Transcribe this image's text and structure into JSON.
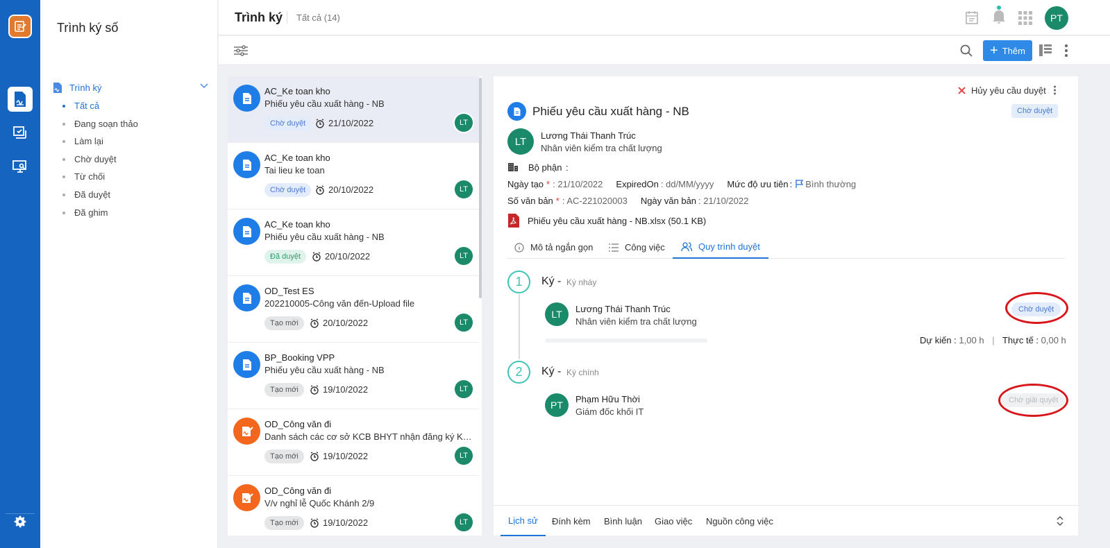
{
  "app": {
    "nav_title": "Trình ký số"
  },
  "sidebar": {
    "group": "Trình ký",
    "items": [
      {
        "label": "Tất cả",
        "active": true
      },
      {
        "label": "Đang soạn thảo"
      },
      {
        "label": "Làm lại"
      },
      {
        "label": "Chờ duyệt"
      },
      {
        "label": "Từ chối"
      },
      {
        "label": "Đã duyệt"
      },
      {
        "label": "Đã ghim"
      }
    ]
  },
  "header": {
    "title": "Trình ký",
    "count_label": "Tất cả (14)",
    "user_initials": "PT"
  },
  "toolbar": {
    "add_label": "Thêm"
  },
  "list": [
    {
      "code": "AC_Ke toan kho",
      "title": "Phiếu yêu cầu xuất hàng - NB",
      "status": "Chờ duyệt",
      "date": "21/10/2022",
      "avatar": "LT",
      "icon": "document-icon"
    },
    {
      "code": "AC_Ke toan kho",
      "title": "Tai lieu ke toan",
      "status": "Chờ duyệt",
      "date": "20/10/2022",
      "avatar": "LT",
      "icon": "document-icon"
    },
    {
      "code": "AC_Ke toan kho",
      "title": "Phiếu yêu cầu xuất hàng - NB",
      "status": "Đã duyệt",
      "date": "20/10/2022",
      "avatar": "LT",
      "icon": "document-icon"
    },
    {
      "code": "OD_Test ES",
      "title": "202210005-Công văn đến-Upload file",
      "status": "Tạo mới",
      "date": "20/10/2022",
      "avatar": "LT",
      "icon": "document-icon"
    },
    {
      "code": "BP_Booking VPP",
      "title": "Phiếu yêu cầu xuất hàng - NB",
      "status": "Tạo mới",
      "date": "19/10/2022",
      "avatar": "LT",
      "icon": "document-icon"
    },
    {
      "code": "OD_Công văn đi",
      "title": "Danh sách các cơ sở KCB BHYT nhận đăng ký KCB ban đầu",
      "status": "Tạo mới",
      "date": "19/10/2022",
      "avatar": "LT",
      "icon": "sign-document-icon"
    },
    {
      "code": "OD_Công văn đi",
      "title": "V/v nghỉ lễ Quốc Khánh 2/9",
      "status": "Tạo mới",
      "date": "19/10/2022",
      "avatar": "LT",
      "icon": "sign-document-icon"
    }
  ],
  "detail": {
    "cancel_label": "Hủy yêu cầu duyệt",
    "title": "Phiếu yêu cầu xuất hàng - NB",
    "status": "Chờ duyệt",
    "creator_initials": "LT",
    "creator_name": "Lương Thái Thanh Trúc",
    "creator_role": "Nhân viên kiểm tra chất lượng",
    "dept_label": "Bộ phận",
    "dept_value": ":",
    "created_label": "Ngày tạo",
    "created_value": ": 21/10/2022",
    "expired_label": "ExpiredOn",
    "expired_value": ": dd/MM/yyyy",
    "priority_label": "Mức độ ưu tiên",
    "priority_value": "Bình thường",
    "docno_label": "Số văn bản",
    "docno_value": ": AC-221020003",
    "docdate_label": "Ngày văn bản",
    "docdate_value": ": 21/10/2022",
    "attachment": "Phiếu yêu cầu xuất hàng - NB.xlsx (50.1 KB)",
    "tabs": [
      "Mô tả ngắn gọn",
      "Công việc",
      "Quy trình duyệt"
    ],
    "steps": [
      {
        "num": "1",
        "title": "Ký",
        "sub": "Ký nháy",
        "initials": "LT",
        "name": "Lương Thái Thanh Trúc",
        "role": "Nhân viên kiểm tra chất lượng",
        "status": "Chờ duyệt",
        "plan_label": "Dự kiến",
        "plan_value": "1,00 h",
        "actual_label": "Thực tế",
        "actual_value": "0,00 h"
      },
      {
        "num": "2",
        "title": "Ký",
        "sub": "Ký chính",
        "initials": "PT",
        "name": "Phạm Hữu Thời",
        "role": "Giám đốc khối IT",
        "status": "Chờ giải quyết"
      }
    ],
    "bottom_tabs": [
      "Lịch sử",
      "Đính kèm",
      "Bình luận",
      "Giao việc",
      "Nguồn công việc"
    ]
  },
  "colors": {
    "rail": "#1565c0",
    "accent": "#1e73d8",
    "avatar": "#1b8a6b",
    "step": "#3ec4b5",
    "highlight": "#d9161b"
  }
}
